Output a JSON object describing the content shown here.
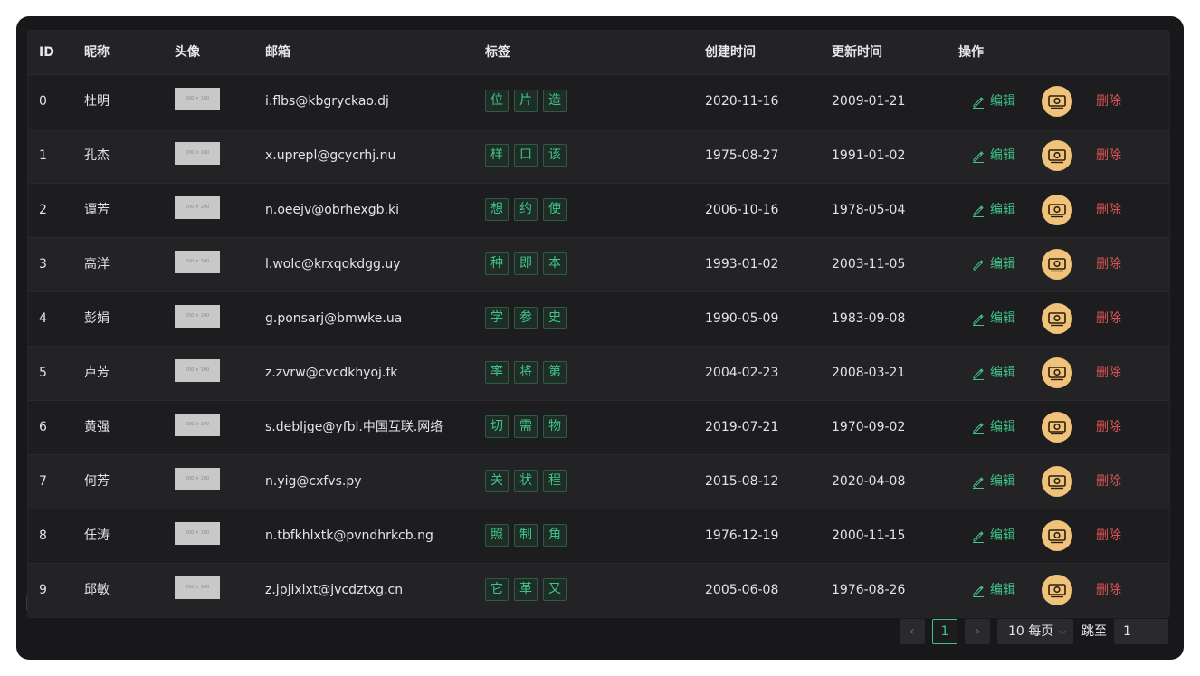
{
  "table": {
    "columns": {
      "id": "ID",
      "nickname": "昵称",
      "avatar": "头像",
      "email": "邮箱",
      "tags": "标签",
      "created": "创建时间",
      "updated": "更新时间",
      "actions": "操作"
    },
    "avatar_placeholder": "200 × 100",
    "actions": {
      "edit": "编辑",
      "delete": "删除"
    },
    "rows": [
      {
        "id": "0",
        "nickname": "杜明",
        "email": "i.flbs@kbgryckao.dj",
        "tags": [
          "位",
          "片",
          "造"
        ],
        "created": "2020-11-16",
        "updated": "2009-01-21"
      },
      {
        "id": "1",
        "nickname": "孔杰",
        "email": "x.uprepl@gcycrhj.nu",
        "tags": [
          "样",
          "口",
          "该"
        ],
        "created": "1975-08-27",
        "updated": "1991-01-02"
      },
      {
        "id": "2",
        "nickname": "谭芳",
        "email": "n.oeejv@obrhexgb.ki",
        "tags": [
          "想",
          "约",
          "使"
        ],
        "created": "2006-10-16",
        "updated": "1978-05-04"
      },
      {
        "id": "3",
        "nickname": "高洋",
        "email": "l.wolc@krxqokdgg.uy",
        "tags": [
          "种",
          "即",
          "本"
        ],
        "created": "1993-01-02",
        "updated": "2003-11-05"
      },
      {
        "id": "4",
        "nickname": "彭娟",
        "email": "g.ponsarj@bmwke.ua",
        "tags": [
          "学",
          "参",
          "史"
        ],
        "created": "1990-05-09",
        "updated": "1983-09-08"
      },
      {
        "id": "5",
        "nickname": "卢芳",
        "email": "z.zvrw@cvcdkhyoj.fk",
        "tags": [
          "率",
          "将",
          "第"
        ],
        "created": "2004-02-23",
        "updated": "2008-03-21"
      },
      {
        "id": "6",
        "nickname": "黄强",
        "email": "s.debljge@yfbl.中国互联.网络",
        "tags": [
          "切",
          "需",
          "物"
        ],
        "created": "2019-07-21",
        "updated": "1970-09-02"
      },
      {
        "id": "7",
        "nickname": "何芳",
        "email": "n.yig@cxfvs.py",
        "tags": [
          "关",
          "状",
          "程"
        ],
        "created": "2015-08-12",
        "updated": "2020-04-08"
      },
      {
        "id": "8",
        "nickname": "任涛",
        "email": "n.tbfkhlxtk@pvndhrkcb.ng",
        "tags": [
          "照",
          "制",
          "角"
        ],
        "created": "1976-12-19",
        "updated": "2000-11-15"
      },
      {
        "id": "9",
        "nickname": "邱敏",
        "email": "z.jpjixlxt@jvcdztxg.cn",
        "tags": [
          "它",
          "革",
          "又"
        ],
        "created": "2005-06-08",
        "updated": "1976-08-26"
      }
    ]
  },
  "pagination": {
    "prev_icon": "chevron-left-icon",
    "next_icon": "chevron-right-icon",
    "current_page": "1",
    "page_size_label": "10 每页",
    "jump_label": "跳至",
    "jump_value": "1"
  },
  "colors": {
    "background": "#18181a",
    "accent": "#3fc48b",
    "danger": "#e05656",
    "money_button": "#f0c27a"
  }
}
